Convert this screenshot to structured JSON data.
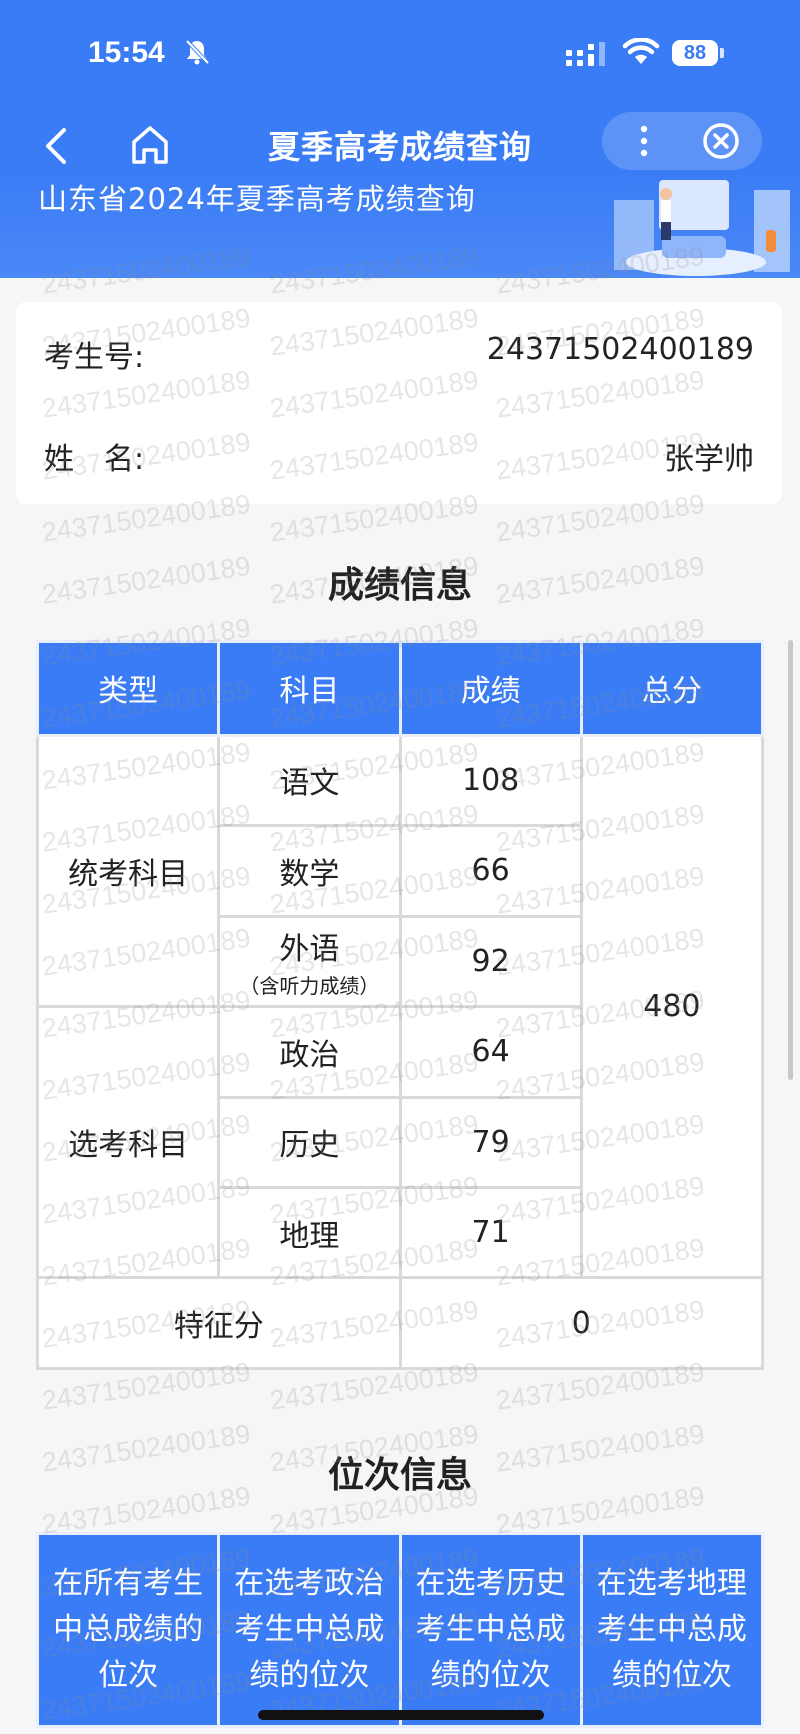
{
  "status_bar": {
    "time": "15:54",
    "battery": "88"
  },
  "nav": {
    "title": "夏季高考成绩查询"
  },
  "banner": {
    "text": "山东省2024年夏季高考成绩查询"
  },
  "watermark": "24371502400189",
  "student": {
    "id_label": "考生号:",
    "id_value": "24371502400189",
    "name_label": "姓　名:",
    "name_value": "张学帅"
  },
  "score_section": {
    "title": "成绩信息",
    "headers": [
      "类型",
      "科目",
      "成绩",
      "总分"
    ],
    "groups": [
      {
        "type": "统考科目",
        "subjects": [
          {
            "name": "语文",
            "note": "",
            "score": "108"
          },
          {
            "name": "数学",
            "note": "",
            "score": "66"
          },
          {
            "name": "外语",
            "note": "（含听力成绩）",
            "score": "92"
          }
        ]
      },
      {
        "type": "选考科目",
        "subjects": [
          {
            "name": "政治",
            "note": "",
            "score": "64"
          },
          {
            "name": "历史",
            "note": "",
            "score": "79"
          },
          {
            "name": "地理",
            "note": "",
            "score": "71"
          }
        ]
      }
    ],
    "total": "480",
    "feature_label": "特征分",
    "feature_value": "0"
  },
  "rank_section": {
    "title": "位次信息",
    "headers": [
      "在所有考生中总成绩的位次",
      "在选考政治考生中总成绩的位次",
      "在选考历史考生中总成绩的位次",
      "在选考地理考生中总成绩的位次"
    ]
  },
  "colors": {
    "primary": "#3a7cf5",
    "background": "#f5f6f8"
  },
  "icons": [
    "bell-muted-icon",
    "signal-icon",
    "wifi-icon",
    "battery-icon",
    "back-arrow-icon",
    "home-icon",
    "more-icon",
    "close-circle-icon"
  ]
}
